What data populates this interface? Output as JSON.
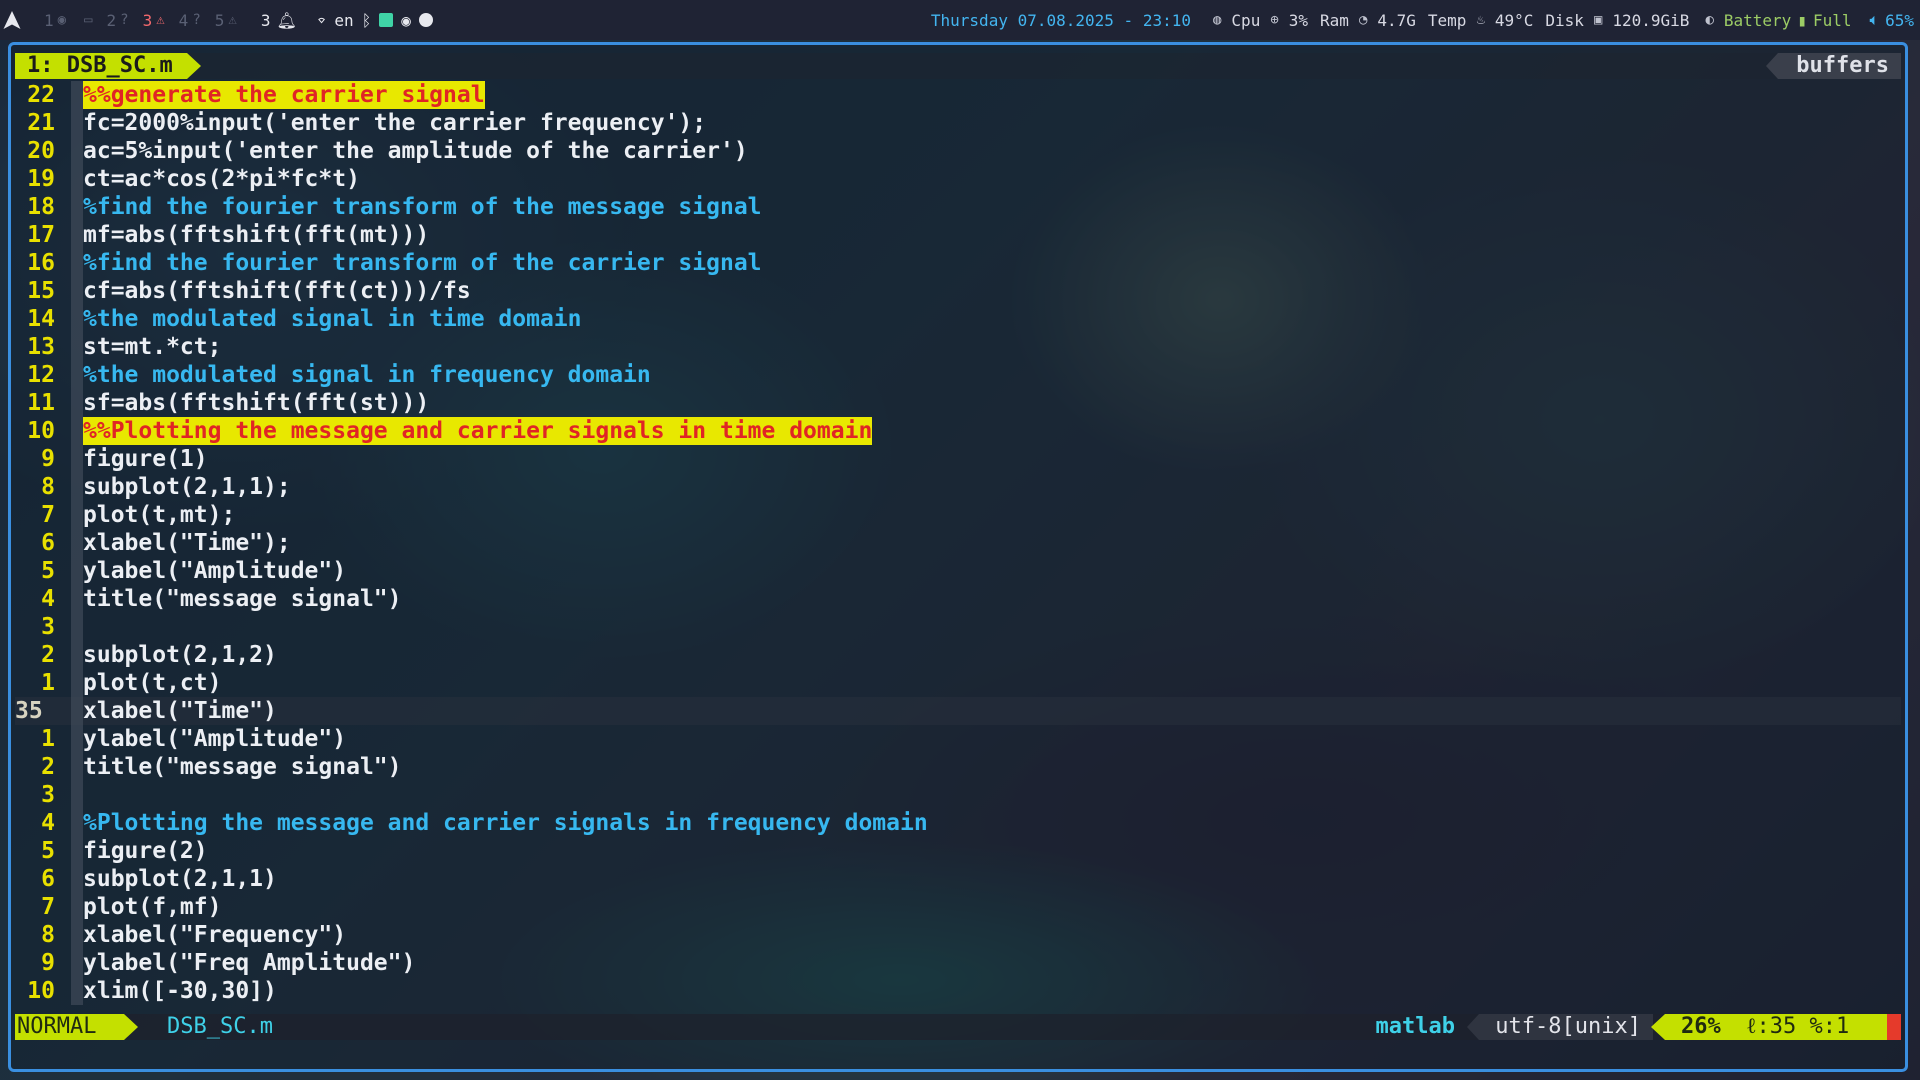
{
  "topbar": {
    "workspaces": [
      {
        "num": "1",
        "icon": "discord-icon",
        "active": false
      },
      {
        "num": "",
        "icon": "folder-icon",
        "active": false
      },
      {
        "num": "2",
        "icon": "help-icon",
        "active": false
      },
      {
        "num": "3",
        "icon": "warning-icon",
        "active": true
      },
      {
        "num": "4",
        "icon": "help-icon",
        "active": false
      },
      {
        "num": "5",
        "icon": "warning-icon",
        "active": false
      }
    ],
    "notifications_count": "3",
    "keyboard_layout": "en",
    "datetime": "Thursday 07.08.2025 - 23:10",
    "cpu_label": "Cpu",
    "cpu_value": "3%",
    "ram_label": "Ram",
    "ram_value": "4.7G",
    "temp_label": "Temp",
    "temp_value": "49°C",
    "disk_label": "Disk",
    "disk_value": "120.9GiB",
    "battery_label": "Battery",
    "battery_value": "Full",
    "volume_value": "65%"
  },
  "editor": {
    "tab_label": "1: DSB_SC.m",
    "buffers_label": "buffers",
    "lines": [
      {
        "num": "22",
        "text": "%%generate the carrier signal",
        "kind": "sec"
      },
      {
        "num": "21",
        "text": "fc=2000%input('enter the carrier frequency');",
        "kind": "code"
      },
      {
        "num": "20",
        "text": "ac=5%input('enter the amplitude of the carrier')",
        "kind": "code"
      },
      {
        "num": "19",
        "text": "ct=ac*cos(2*pi*fc*t)",
        "kind": "code"
      },
      {
        "num": "18",
        "text": "%find the fourier transform of the message signal",
        "kind": "cmt"
      },
      {
        "num": "17",
        "text": "mf=abs(fftshift(fft(mt)))",
        "kind": "code"
      },
      {
        "num": "16",
        "text": "%find the fourier transform of the carrier signal",
        "kind": "cmt"
      },
      {
        "num": "15",
        "text": "cf=abs(fftshift(fft(ct)))/fs",
        "kind": "code"
      },
      {
        "num": "14",
        "text": "%the modulated signal in time domain",
        "kind": "cmt"
      },
      {
        "num": "13",
        "text": "st=mt.*ct;",
        "kind": "code"
      },
      {
        "num": "12",
        "text": "%the modulated signal in frequency domain",
        "kind": "cmt"
      },
      {
        "num": "11",
        "text": "sf=abs(fftshift(fft(st)))",
        "kind": "code"
      },
      {
        "num": "10",
        "text": "%%Plotting the message and carrier signals in time domain",
        "kind": "sec"
      },
      {
        "num": "9",
        "text": "figure(1)",
        "kind": "code"
      },
      {
        "num": "8",
        "text": "subplot(2,1,1);",
        "kind": "code"
      },
      {
        "num": "7",
        "text": "plot(t,mt);",
        "kind": "code"
      },
      {
        "num": "6",
        "text": "xlabel(\"Time\");",
        "kind": "code"
      },
      {
        "num": "5",
        "text": "ylabel(\"Amplitude\")",
        "kind": "code"
      },
      {
        "num": "4",
        "text": "title(\"message signal\")",
        "kind": "code"
      },
      {
        "num": "3",
        "text": "",
        "kind": "code"
      },
      {
        "num": "2",
        "text": "subplot(2,1,2)",
        "kind": "code"
      },
      {
        "num": "1",
        "text": "plot(t,ct)",
        "kind": "code"
      },
      {
        "num": "35",
        "text": "xlabel(\"Time\")",
        "kind": "current"
      },
      {
        "num": "1",
        "text": "ylabel(\"Amplitude\")",
        "kind": "code"
      },
      {
        "num": "2",
        "text": "title(\"message signal\")",
        "kind": "code"
      },
      {
        "num": "3",
        "text": "",
        "kind": "code"
      },
      {
        "num": "4",
        "text": "%Plotting the message and carrier signals in frequency domain",
        "kind": "cmt"
      },
      {
        "num": "5",
        "text": "figure(2)",
        "kind": "code"
      },
      {
        "num": "6",
        "text": "subplot(2,1,1)",
        "kind": "code"
      },
      {
        "num": "7",
        "text": "plot(f,mf)",
        "kind": "code"
      },
      {
        "num": "8",
        "text": "xlabel(\"Frequency\")",
        "kind": "code"
      },
      {
        "num": "9",
        "text": "ylabel(\"Freq Amplitude\")",
        "kind": "code"
      },
      {
        "num": "10",
        "text": "xlim([-30,30])",
        "kind": "code"
      }
    ]
  },
  "statusline": {
    "mode": "NORMAL",
    "filename": "DSB_SC.m",
    "filetype": "matlab",
    "encoding": "utf-8[unix]",
    "percent": "26%",
    "position": "ℓ:35 %:1"
  },
  "colors": {
    "accent": "#c4e000",
    "comment": "#37b8f0",
    "linenr": "#e8e000",
    "border": "#3a8fe0"
  }
}
